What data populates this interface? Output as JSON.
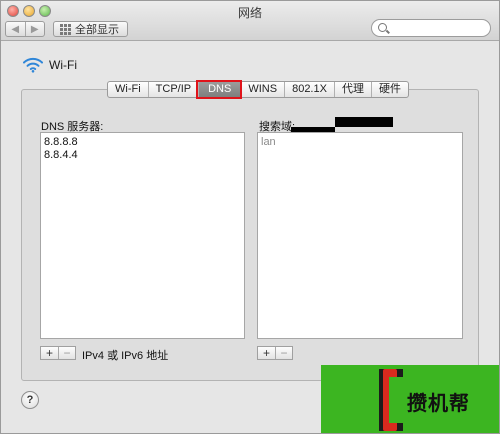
{
  "window": {
    "title": "网络"
  },
  "toolbar": {
    "show_all_label": "全部显示",
    "back_icon": "chevron-left-icon",
    "forward_icon": "chevron-right-icon",
    "search_icon": "search-icon"
  },
  "header": {
    "interface_name": "Wi-Fi",
    "icon": "wifi-icon"
  },
  "tabs": [
    {
      "label": "Wi-Fi"
    },
    {
      "label": "TCP/IP"
    },
    {
      "label": "DNS",
      "active": true
    },
    {
      "label": "WINS"
    },
    {
      "label": "802.1X"
    },
    {
      "label": "代理"
    },
    {
      "label": "硬件"
    }
  ],
  "dns": {
    "servers_label": "DNS 服务器:",
    "servers": [
      "8.8.8.8",
      "8.8.4.4"
    ],
    "hint": "IPv4 或 IPv6 地址",
    "add_label": "+",
    "remove_label": "−"
  },
  "search_domains": {
    "label": "搜索域:",
    "items": [
      "lan"
    ],
    "add_label": "+",
    "remove_label": "−"
  },
  "help": {
    "label": "?"
  },
  "watermark": {
    "text": "攒机帮"
  },
  "colors": {
    "highlight": "#e0131a",
    "watermark_bg": "#3cb521"
  }
}
